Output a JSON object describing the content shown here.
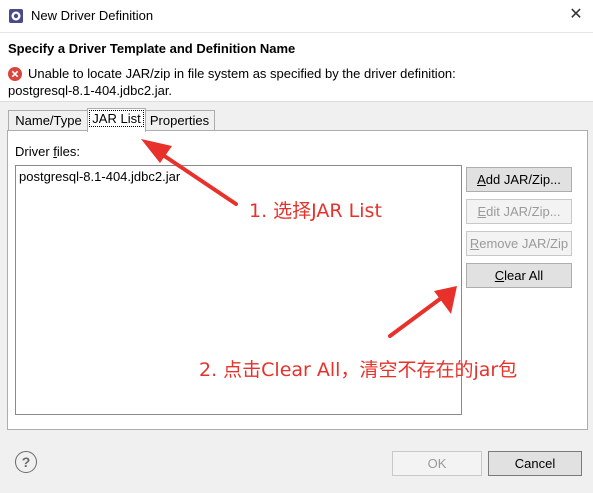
{
  "window": {
    "title": "New Driver Definition",
    "close_glyph": "✕"
  },
  "header": {
    "title": "Specify a Driver Template and Definition Name",
    "message_line1": "Unable to locate JAR/zip in file system as specified by the driver definition:",
    "message_line2": "postgresql-8.1-404.jdbc2.jar."
  },
  "tabs": [
    {
      "label": "Name/Type"
    },
    {
      "label": "JAR List"
    },
    {
      "label": "Properties"
    }
  ],
  "jar_list": {
    "label_prefix": "Driver ",
    "label_underlined": "f",
    "label_suffix": "iles:",
    "files": [
      "postgresql-8.1-404.jdbc2.jar"
    ]
  },
  "buttons": {
    "add": {
      "u": "A",
      "rest": "dd JAR/Zip..."
    },
    "edit": {
      "u": "E",
      "rest": "dit JAR/Zip..."
    },
    "remove": {
      "u": "R",
      "rest": "emove JAR/Zip"
    },
    "clear": {
      "u": "C",
      "rest": "lear All"
    },
    "ok": "OK",
    "cancel": "Cancel"
  },
  "help_glyph": "?",
  "annotations": {
    "step1": "1. 选择JAR List",
    "step2": "2. 点击Clear All，清空不存在的jar包",
    "arrow_color": "#e8312a"
  }
}
